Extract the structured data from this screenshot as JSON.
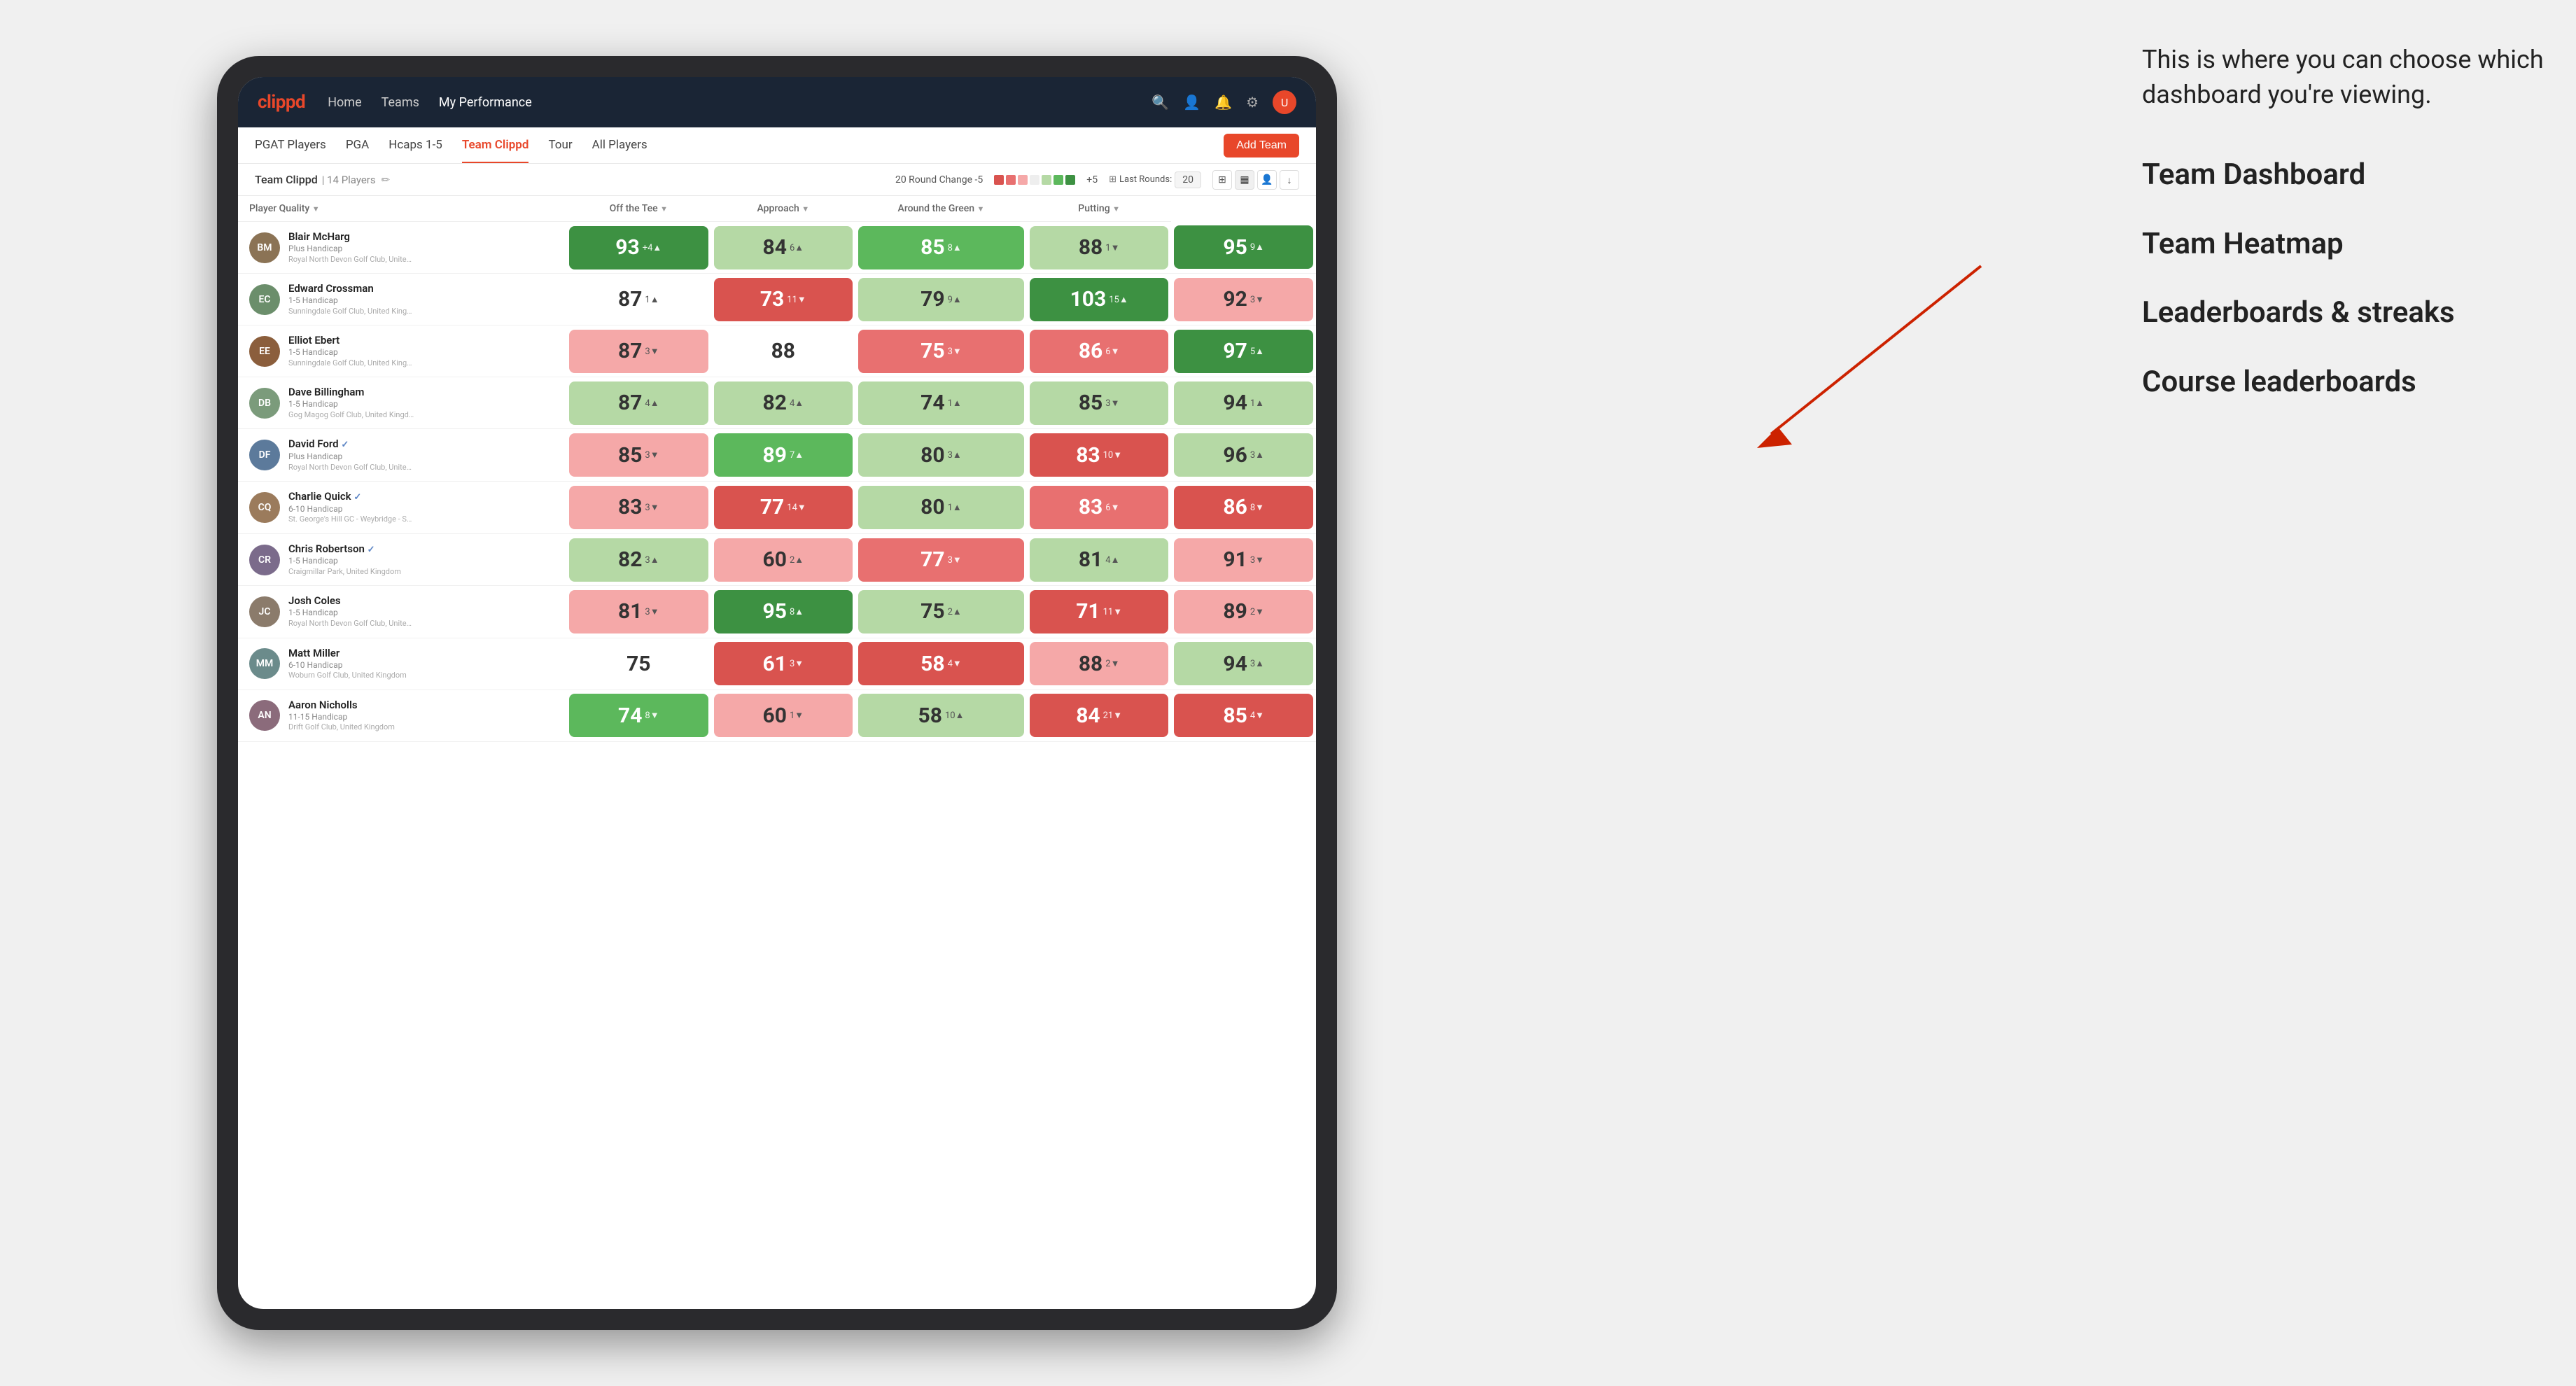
{
  "annotation": {
    "bubble_text": "This is where you can choose which dashboard you're viewing.",
    "labels": [
      "Team Dashboard",
      "Team Heatmap",
      "Leaderboards & streaks",
      "Course leaderboards"
    ]
  },
  "nav": {
    "logo": "clippd",
    "items": [
      "Home",
      "Teams",
      "My Performance"
    ],
    "active_item": "My Performance"
  },
  "sub_nav": {
    "items": [
      "PGAT Players",
      "PGA",
      "Hcaps 1-5",
      "Team Clippd",
      "Tour",
      "All Players"
    ],
    "active_item": "Team Clippd",
    "add_team_label": "Add Team"
  },
  "team_bar": {
    "name": "Team Clippd",
    "separator": "|",
    "count": "14 Players",
    "round_change_label": "20 Round Change",
    "change_min": "-5",
    "change_max": "+5",
    "last_rounds_label": "Last Rounds:",
    "last_rounds_value": "20"
  },
  "table": {
    "columns": [
      {
        "key": "player",
        "label": "Player Quality",
        "sortable": true
      },
      {
        "key": "off_tee",
        "label": "Off the Tee",
        "sortable": true
      },
      {
        "key": "approach",
        "label": "Approach",
        "sortable": true
      },
      {
        "key": "around_green",
        "label": "Around the Green",
        "sortable": true
      },
      {
        "key": "putting",
        "label": "Putting",
        "sortable": true
      }
    ],
    "rows": [
      {
        "name": "Blair McHarg",
        "handicap": "Plus Handicap",
        "club": "Royal North Devon Golf Club, United Kingdom",
        "avatar_initials": "BM",
        "avatar_color": "#8B7355",
        "player_quality": {
          "value": 93,
          "change": "+4",
          "dir": "up",
          "bg": "bg-dark-green",
          "text": "light"
        },
        "off_tee": {
          "value": 84,
          "change": "6",
          "dir": "up",
          "bg": "bg-light-green",
          "text": "dark"
        },
        "approach": {
          "value": 85,
          "change": "8",
          "dir": "up",
          "bg": "bg-green",
          "text": "light"
        },
        "around_green": {
          "value": 88,
          "change": "1",
          "dir": "down",
          "bg": "bg-light-green",
          "text": "dark"
        },
        "putting": {
          "value": 95,
          "change": "9",
          "dir": "up",
          "bg": "bg-dark-green",
          "text": "light"
        }
      },
      {
        "name": "Edward Crossman",
        "handicap": "1-5 Handicap",
        "club": "Sunningdale Golf Club, United Kingdom",
        "avatar_initials": "EC",
        "avatar_color": "#6B8E6B",
        "player_quality": {
          "value": 87,
          "change": "1",
          "dir": "up",
          "bg": "bg-white",
          "text": "dark"
        },
        "off_tee": {
          "value": 73,
          "change": "11",
          "dir": "down",
          "bg": "bg-dark-red",
          "text": "light"
        },
        "approach": {
          "value": 79,
          "change": "9",
          "dir": "up",
          "bg": "bg-light-green",
          "text": "dark"
        },
        "around_green": {
          "value": 103,
          "change": "15",
          "dir": "up",
          "bg": "bg-dark-green",
          "text": "light"
        },
        "putting": {
          "value": 92,
          "change": "3",
          "dir": "down",
          "bg": "bg-light-red",
          "text": "dark"
        }
      },
      {
        "name": "Elliot Ebert",
        "handicap": "1-5 Handicap",
        "club": "Sunningdale Golf Club, United Kingdom",
        "avatar_initials": "EE",
        "avatar_color": "#8B5E3C",
        "player_quality": {
          "value": 87,
          "change": "3",
          "dir": "down",
          "bg": "bg-light-red",
          "text": "dark"
        },
        "off_tee": {
          "value": 88,
          "change": "",
          "dir": "none",
          "bg": "bg-white",
          "text": "dark"
        },
        "approach": {
          "value": 75,
          "change": "3",
          "dir": "down",
          "bg": "bg-red",
          "text": "light"
        },
        "around_green": {
          "value": 86,
          "change": "6",
          "dir": "down",
          "bg": "bg-red",
          "text": "light"
        },
        "putting": {
          "value": 97,
          "change": "5",
          "dir": "up",
          "bg": "bg-dark-green",
          "text": "light"
        }
      },
      {
        "name": "Dave Billingham",
        "handicap": "1-5 Handicap",
        "club": "Gog Magog Golf Club, United Kingdom",
        "avatar_initials": "DB",
        "avatar_color": "#7B9B7B",
        "player_quality": {
          "value": 87,
          "change": "4",
          "dir": "up",
          "bg": "bg-light-green",
          "text": "dark"
        },
        "off_tee": {
          "value": 82,
          "change": "4",
          "dir": "up",
          "bg": "bg-light-green",
          "text": "dark"
        },
        "approach": {
          "value": 74,
          "change": "1",
          "dir": "up",
          "bg": "bg-light-green",
          "text": "dark"
        },
        "around_green": {
          "value": 85,
          "change": "3",
          "dir": "down",
          "bg": "bg-light-green",
          "text": "dark"
        },
        "putting": {
          "value": 94,
          "change": "1",
          "dir": "up",
          "bg": "bg-light-green",
          "text": "dark"
        }
      },
      {
        "name": "David Ford",
        "handicap": "Plus Handicap",
        "club": "Royal North Devon Golf Club, United Kingdom",
        "avatar_initials": "DF",
        "avatar_color": "#5C7A9B",
        "verified": true,
        "player_quality": {
          "value": 85,
          "change": "3",
          "dir": "down",
          "bg": "bg-light-red",
          "text": "dark"
        },
        "off_tee": {
          "value": 89,
          "change": "7",
          "dir": "up",
          "bg": "bg-green",
          "text": "light"
        },
        "approach": {
          "value": 80,
          "change": "3",
          "dir": "up",
          "bg": "bg-light-green",
          "text": "dark"
        },
        "around_green": {
          "value": 83,
          "change": "10",
          "dir": "down",
          "bg": "bg-dark-red",
          "text": "light"
        },
        "putting": {
          "value": 96,
          "change": "3",
          "dir": "up",
          "bg": "bg-light-green",
          "text": "dark"
        }
      },
      {
        "name": "Charlie Quick",
        "handicap": "6-10 Handicap",
        "club": "St. George's Hill GC - Weybridge - Surrey, Uni...",
        "avatar_initials": "CQ",
        "avatar_color": "#9B7B5C",
        "verified": true,
        "player_quality": {
          "value": 83,
          "change": "3",
          "dir": "down",
          "bg": "bg-light-red",
          "text": "dark"
        },
        "off_tee": {
          "value": 77,
          "change": "14",
          "dir": "down",
          "bg": "bg-dark-red",
          "text": "light"
        },
        "approach": {
          "value": 80,
          "change": "1",
          "dir": "up",
          "bg": "bg-light-green",
          "text": "dark"
        },
        "around_green": {
          "value": 83,
          "change": "6",
          "dir": "down",
          "bg": "bg-red",
          "text": "light"
        },
        "putting": {
          "value": 86,
          "change": "8",
          "dir": "down",
          "bg": "bg-dark-red",
          "text": "light"
        }
      },
      {
        "name": "Chris Robertson",
        "handicap": "1-5 Handicap",
        "club": "Craigmillar Park, United Kingdom",
        "avatar_initials": "CR",
        "avatar_color": "#7B6B8B",
        "verified": true,
        "player_quality": {
          "value": 82,
          "change": "3",
          "dir": "up",
          "bg": "bg-light-green",
          "text": "dark"
        },
        "off_tee": {
          "value": 60,
          "change": "2",
          "dir": "up",
          "bg": "bg-light-red",
          "text": "dark"
        },
        "approach": {
          "value": 77,
          "change": "3",
          "dir": "down",
          "bg": "bg-red",
          "text": "light"
        },
        "around_green": {
          "value": 81,
          "change": "4",
          "dir": "up",
          "bg": "bg-light-green",
          "text": "dark"
        },
        "putting": {
          "value": 91,
          "change": "3",
          "dir": "down",
          "bg": "bg-light-red",
          "text": "dark"
        }
      },
      {
        "name": "Josh Coles",
        "handicap": "1-5 Handicap",
        "club": "Royal North Devon Golf Club, United Kingdom",
        "avatar_initials": "JC",
        "avatar_color": "#8B7B6B",
        "player_quality": {
          "value": 81,
          "change": "3",
          "dir": "down",
          "bg": "bg-light-red",
          "text": "dark"
        },
        "off_tee": {
          "value": 95,
          "change": "8",
          "dir": "up",
          "bg": "bg-dark-green",
          "text": "light"
        },
        "approach": {
          "value": 75,
          "change": "2",
          "dir": "up",
          "bg": "bg-light-green",
          "text": "dark"
        },
        "around_green": {
          "value": 71,
          "change": "11",
          "dir": "down",
          "bg": "bg-dark-red",
          "text": "light"
        },
        "putting": {
          "value": 89,
          "change": "2",
          "dir": "down",
          "bg": "bg-light-red",
          "text": "dark"
        }
      },
      {
        "name": "Matt Miller",
        "handicap": "6-10 Handicap",
        "club": "Woburn Golf Club, United Kingdom",
        "avatar_initials": "MM",
        "avatar_color": "#6B8B8B",
        "player_quality": {
          "value": 75,
          "change": "",
          "dir": "none",
          "bg": "bg-white",
          "text": "dark"
        },
        "off_tee": {
          "value": 61,
          "change": "3",
          "dir": "down",
          "bg": "bg-dark-red",
          "text": "light"
        },
        "approach": {
          "value": 58,
          "change": "4",
          "dir": "down",
          "bg": "bg-dark-red",
          "text": "light"
        },
        "around_green": {
          "value": 88,
          "change": "2",
          "dir": "down",
          "bg": "bg-light-red",
          "text": "dark"
        },
        "putting": {
          "value": 94,
          "change": "3",
          "dir": "up",
          "bg": "bg-light-green",
          "text": "dark"
        }
      },
      {
        "name": "Aaron Nicholls",
        "handicap": "11-15 Handicap",
        "club": "Drift Golf Club, United Kingdom",
        "avatar_initials": "AN",
        "avatar_color": "#8B6B7B",
        "player_quality": {
          "value": 74,
          "change": "8",
          "dir": "down",
          "bg": "bg-green",
          "text": "light"
        },
        "off_tee": {
          "value": 60,
          "change": "1",
          "dir": "down",
          "bg": "bg-light-red",
          "text": "dark"
        },
        "approach": {
          "value": 58,
          "change": "10",
          "dir": "up",
          "bg": "bg-light-green",
          "text": "dark"
        },
        "around_green": {
          "value": 84,
          "change": "21",
          "dir": "down",
          "bg": "bg-dark-red",
          "text": "light"
        },
        "putting": {
          "value": 85,
          "change": "4",
          "dir": "down",
          "bg": "bg-dark-red",
          "text": "light"
        }
      }
    ]
  }
}
